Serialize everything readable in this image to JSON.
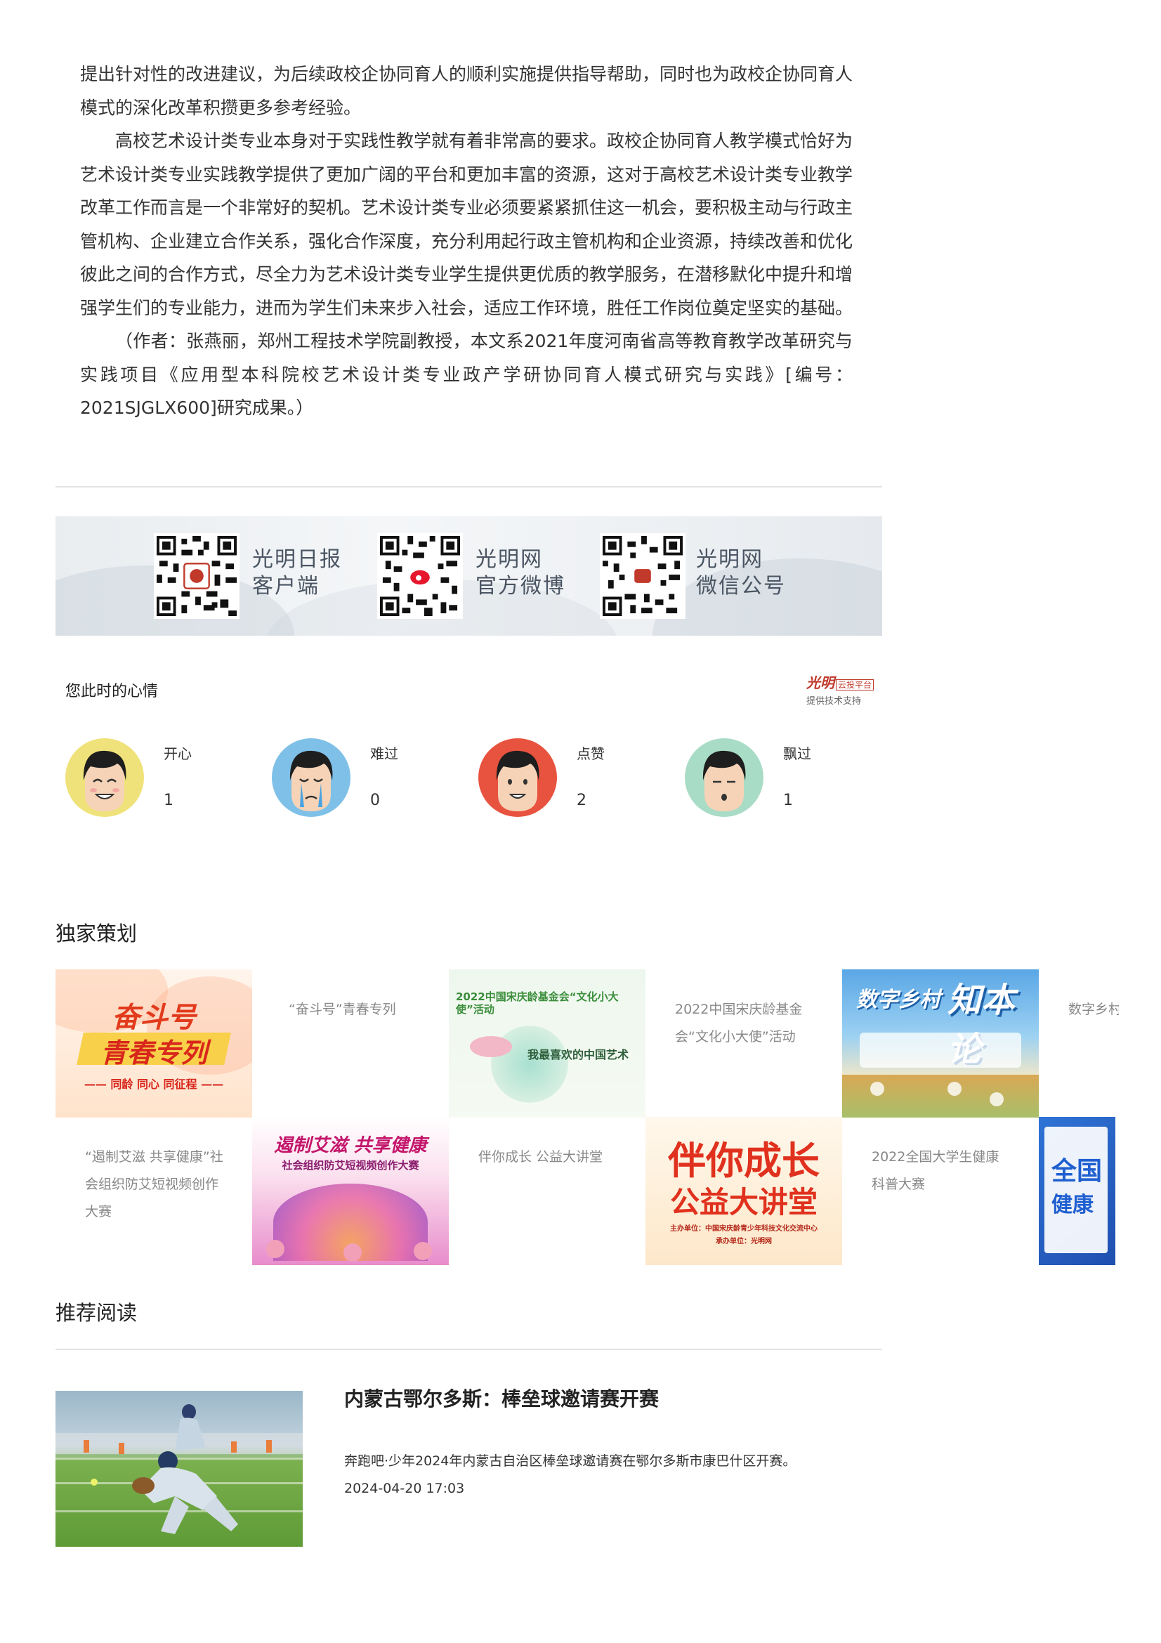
{
  "article": {
    "paragraphs": [
      "提出针对性的改进建议，为后续政校企协同育人的顺利实施提供指导帮助，同时也为政校企协同育人模式的深化改革积攒更多参考经验。",
      "高校艺术设计类专业本身对于实践性教学就有着非常高的要求。政校企协同育人教学模式恰好为艺术设计类专业实践教学提供了更加广阔的平台和更加丰富的资源，这对于高校艺术设计类专业教学改革工作而言是一个非常好的契机。艺术设计类专业必须要紧紧抓住这一机会，要积极主动与行政主管机构、企业建立合作关系，强化合作深度，充分利用起行政主管机构和企业资源，持续改善和优化彼此之间的合作方式，尽全力为艺术设计类专业学生提供更优质的教学服务，在潜移默化中提升和增强学生们的专业能力，进而为学生们未来步入社会，适应工作环境，胜任工作岗位奠定坚实的基础。",
      "（作者：张燕丽，郑州工程技术学院副教授，本文系2021年度河南省高等教育教学改革研究与实践项目《应用型本科院校艺术设计类专业政产学研协同育人模式研究与实践》[编号：2021SJGLX600]研究成果。）"
    ]
  },
  "qr_banner": {
    "items": [
      {
        "line1": "光明日报",
        "line2": "客户端"
      },
      {
        "line1": "光明网",
        "line2": "官方微博"
      },
      {
        "line1": "光明网",
        "line2": "微信公号"
      }
    ]
  },
  "mood": {
    "title": "您此时的心情",
    "brand": {
      "logo_text": "光明",
      "logo_tag": "云投平台",
      "support": "提供技术支持"
    },
    "items": [
      {
        "label": "开心",
        "count": "1",
        "bg": "#f0e27a"
      },
      {
        "label": "难过",
        "count": "0",
        "bg": "#7ec0e8"
      },
      {
        "label": "点赞",
        "count": "2",
        "bg": "#e8533f"
      },
      {
        "label": "飘过",
        "count": "1",
        "bg": "#a9dcc6"
      }
    ]
  },
  "exclusive": {
    "title": "独家策划",
    "row1": [
      {
        "image_text_1": "奋斗号",
        "image_text_2": "青春专列",
        "image_text_3": "—— 同龄 同心 同征程 ——",
        "caption": "“奋斗号”青春专列"
      },
      {
        "image_text_1": "2022中国宋庆龄基金会“文化小大使”活动",
        "image_text_2": "我最喜欢的中国艺术",
        "caption": "2022中国宋庆龄基金会“文化小大使”活动"
      },
      {
        "image_text_1": "数字乡村",
        "image_text_2": "知本论",
        "caption": "数字乡村"
      }
    ],
    "row2": [
      {
        "caption": "“遏制艾滋 共享健康”社会组织防艾短视频创作大赛",
        "image_text_1": "遏制艾滋  共享健康",
        "image_text_2": "社会组织防艾短视频创作大赛"
      },
      {
        "caption": "伴你成长 公益大讲堂",
        "image_text_1": "伴你成长",
        "image_text_2": "公益大讲堂",
        "image_text_3": "主办单位：中国宋庆龄青少年科技文化交流中心",
        "image_text_4": "承办单位：光明网"
      },
      {
        "caption": "2022全国大学生健康科普大赛",
        "image_text_1": "全国",
        "image_text_2": "健康"
      }
    ]
  },
  "recommend": {
    "title": "推荐阅读",
    "items": [
      {
        "headline": "内蒙古鄂尔多斯：棒垒球邀请赛开赛",
        "summary": "奔跑吧·少年2024年内蒙古自治区棒垒球邀请赛在鄂尔多斯市康巴什区开赛。",
        "date": "2024-04-20 17:03"
      }
    ]
  }
}
